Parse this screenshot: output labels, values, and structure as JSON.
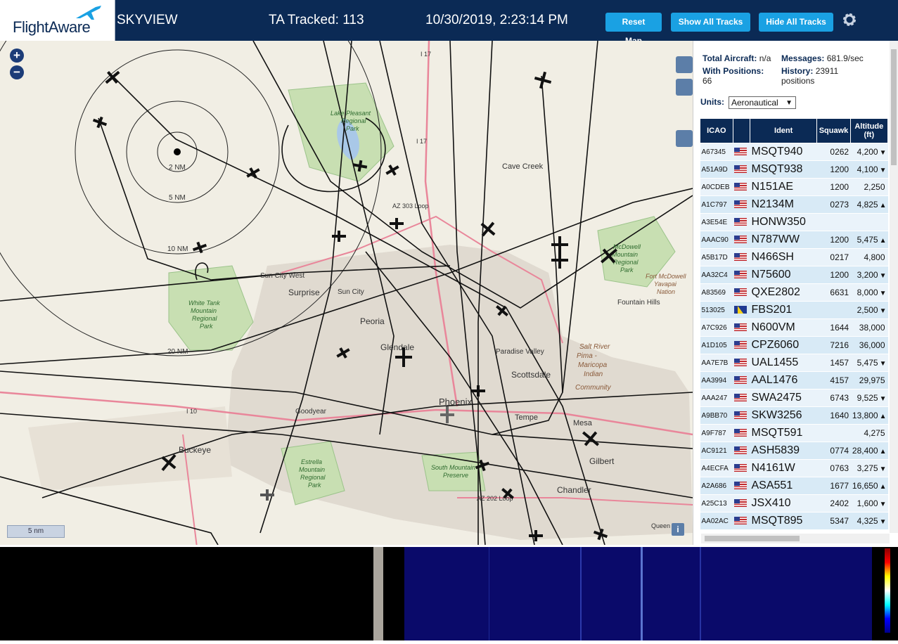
{
  "header": {
    "logo_text": "FlightAware",
    "site_name": "SKYVIEW",
    "ta_tracked": "TA Tracked: 113",
    "datetime": "10/30/2019, 2:23:14 PM",
    "buttons": {
      "reset_map": "Reset Map",
      "show_all": "Show All Tracks",
      "hide_all": "Hide All Tracks"
    },
    "settings_icon": "gear-icon"
  },
  "map": {
    "zoom_in": "+",
    "zoom_out": "−",
    "scale_label": "5 nm",
    "info_label": "i",
    "range_rings": [
      "2 NM",
      "5 NM",
      "10 NM",
      "20 NM"
    ],
    "places": [
      "Cave Creek",
      "Lake Pleasant Regional Park",
      "AZ 303 Loop",
      "I 17",
      "Sun City West",
      "Surprise",
      "Sun City",
      "Peoria",
      "Glendale",
      "Paradise Valley",
      "Scottsdale",
      "White Tank Mountain Regional Park",
      "McDowell Mountain Regional Park",
      "Fort McDowell Yavapai Nation",
      "Fountain Hills",
      "Salt River Pima - Maricopa Indian Community",
      "Phoenix",
      "Tempe",
      "Mesa",
      "Gilbert",
      "Chandler",
      "Goodyear",
      "Buckeye",
      "I 10",
      "Estrella Mountain Regional Park",
      "South Mountain Preserve",
      "AZ 202 Loop",
      "Queen Cr"
    ],
    "colors": {
      "land": "#f1eee4",
      "track": "#111111",
      "urban": "#e0dad0",
      "park": "#c8dfb2",
      "highway": "#e9869a"
    }
  },
  "stats": {
    "total_label": "Total Aircraft:",
    "total_value": "n/a",
    "with_pos_label": "With Positions:",
    "with_pos_value": "66",
    "messages_label": "Messages:",
    "messages_value": "681.9/sec",
    "history_label": "History:",
    "history_value": "23911",
    "history_unit": "positions",
    "units_label": "Units:",
    "units_value": "Aeronautical"
  },
  "table": {
    "columns": [
      "ICAO",
      "",
      "Ident",
      "Squawk",
      "Altitude (ft)"
    ],
    "rows": [
      {
        "icao": "A67345",
        "flag": "us",
        "ident": "MSQT940",
        "squawk": "0262",
        "alt": "4,200",
        "trend": "▼"
      },
      {
        "icao": "A51A9D",
        "flag": "us",
        "ident": "MSQT938",
        "squawk": "1200",
        "alt": "4,100",
        "trend": "▼"
      },
      {
        "icao": "A0CDEB",
        "flag": "us",
        "ident": "N151AE",
        "squawk": "1200",
        "alt": "2,250",
        "trend": ""
      },
      {
        "icao": "A1C797",
        "flag": "us",
        "ident": "N2134M",
        "squawk": "0273",
        "alt": "4,825",
        "trend": "▲"
      },
      {
        "icao": "A3E54E",
        "flag": "us",
        "ident": "HONW350",
        "squawk": "",
        "alt": "",
        "trend": ""
      },
      {
        "icao": "AAAC90",
        "flag": "us",
        "ident": "N787WW",
        "squawk": "1200",
        "alt": "5,475",
        "trend": "▲"
      },
      {
        "icao": "A5B17D",
        "flag": "us",
        "ident": "N466SH",
        "squawk": "0217",
        "alt": "4,800",
        "trend": ""
      },
      {
        "icao": "AA32C4",
        "flag": "us",
        "ident": "N75600",
        "squawk": "1200",
        "alt": "3,200",
        "trend": "▼"
      },
      {
        "icao": "A83569",
        "flag": "us",
        "ident": "QXE2802",
        "squawk": "6631",
        "alt": "8,000",
        "trend": "▼"
      },
      {
        "icao": "513025",
        "flag": "ba",
        "ident": "FBS201",
        "squawk": "",
        "alt": "2,500",
        "trend": "▼"
      },
      {
        "icao": "A7C926",
        "flag": "us",
        "ident": "N600VM",
        "squawk": "1644",
        "alt": "38,000",
        "trend": ""
      },
      {
        "icao": "A1D105",
        "flag": "us",
        "ident": "CPZ6060",
        "squawk": "7216",
        "alt": "36,000",
        "trend": ""
      },
      {
        "icao": "AA7E7B",
        "flag": "us",
        "ident": "UAL1455",
        "squawk": "1457",
        "alt": "5,475",
        "trend": "▼"
      },
      {
        "icao": "AA3994",
        "flag": "us",
        "ident": "AAL1476",
        "squawk": "4157",
        "alt": "29,975",
        "trend": ""
      },
      {
        "icao": "AAA247",
        "flag": "us",
        "ident": "SWA2475",
        "squawk": "6743",
        "alt": "9,525",
        "trend": "▼"
      },
      {
        "icao": "A9BB70",
        "flag": "us",
        "ident": "SKW3256",
        "squawk": "1640",
        "alt": "13,800",
        "trend": "▲"
      },
      {
        "icao": "A9F787",
        "flag": "us",
        "ident": "MSQT591",
        "squawk": "",
        "alt": "4,275",
        "trend": ""
      },
      {
        "icao": "AC9121",
        "flag": "us",
        "ident": "ASH5839",
        "squawk": "0774",
        "alt": "28,400",
        "trend": "▲"
      },
      {
        "icao": "A4ECFA",
        "flag": "us",
        "ident": "N4161W",
        "squawk": "0763",
        "alt": "3,275",
        "trend": "▼"
      },
      {
        "icao": "A2A686",
        "flag": "us",
        "ident": "ASA551",
        "squawk": "1677",
        "alt": "16,650",
        "trend": "▲"
      },
      {
        "icao": "A25C13",
        "flag": "us",
        "ident": "JSX410",
        "squawk": "2402",
        "alt": "1,600",
        "trend": "▼"
      },
      {
        "icao": "AA02AC",
        "flag": "us",
        "ident": "MSQT895",
        "squawk": "5347",
        "alt": "4,325",
        "trend": "▼"
      }
    ]
  },
  "spectrum": {
    "colors": {
      "background": "#000000",
      "waterfall": "#0a0a6a",
      "divider": "#aaa59d"
    }
  }
}
